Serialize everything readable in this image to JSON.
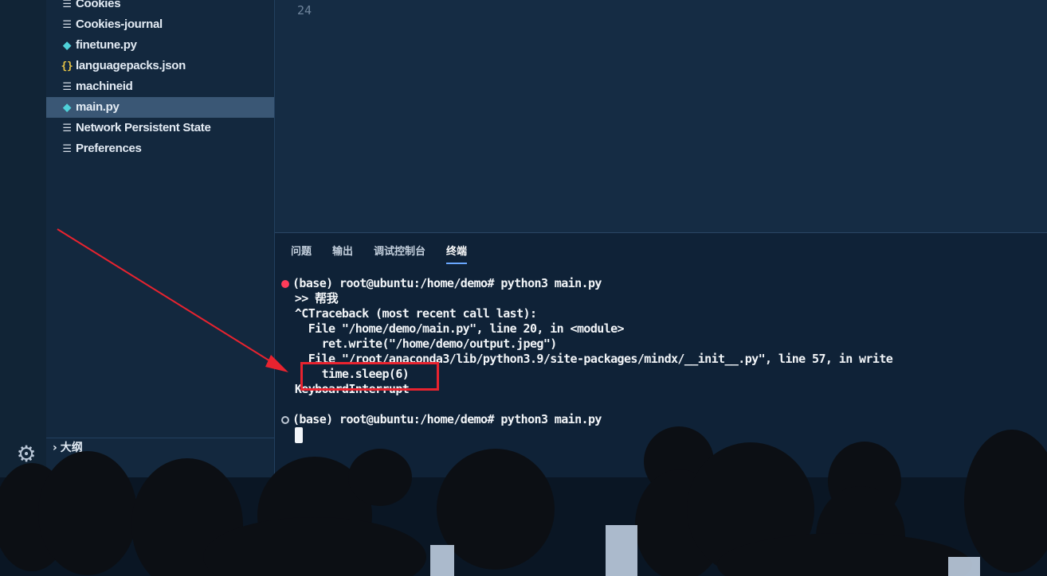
{
  "sidebar": {
    "files": [
      {
        "name": "Cookies",
        "icon": "text-file-icon"
      },
      {
        "name": "Cookies-journal",
        "icon": "text-file-icon"
      },
      {
        "name": "finetune.py",
        "icon": "python-file-icon"
      },
      {
        "name": "languagepacks.json",
        "icon": "json-file-icon"
      },
      {
        "name": "machineid",
        "icon": "text-file-icon"
      },
      {
        "name": "main.py",
        "icon": "python-file-icon",
        "active": true
      },
      {
        "name": "Network Persistent State",
        "icon": "text-file-icon"
      },
      {
        "name": "Preferences",
        "icon": "text-file-icon"
      }
    ],
    "outline_label": "大纲"
  },
  "editor": {
    "line_number": "24"
  },
  "panel": {
    "tabs": [
      "问题",
      "输出",
      "调试控制台",
      "终端"
    ],
    "active_tab": "终端"
  },
  "terminal": {
    "lines": [
      "(base) root@ubuntu:/home/demo# python3 main.py",
      ">> 帮我",
      "^CTraceback (most recent call last):",
      "  File \"/home/demo/main.py\", line 20, in <module>",
      "    ret.write(\"/home/demo/output.jpeg\")",
      "  File \"/root/anaconda3/lib/python3.9/site-packages/mindx/__init__.py\", line 57, in write",
      "    time.sleep(6)",
      "KeyboardInterrupt",
      "",
      "(base) root@ubuntu:/home/demo# python3 main.py"
    ]
  },
  "colors": {
    "accent_tab_underline": "#6aa8ff",
    "error_dot": "#ff3c5a",
    "highlight_box": "#e8232f",
    "arrow": "#e8232f"
  }
}
